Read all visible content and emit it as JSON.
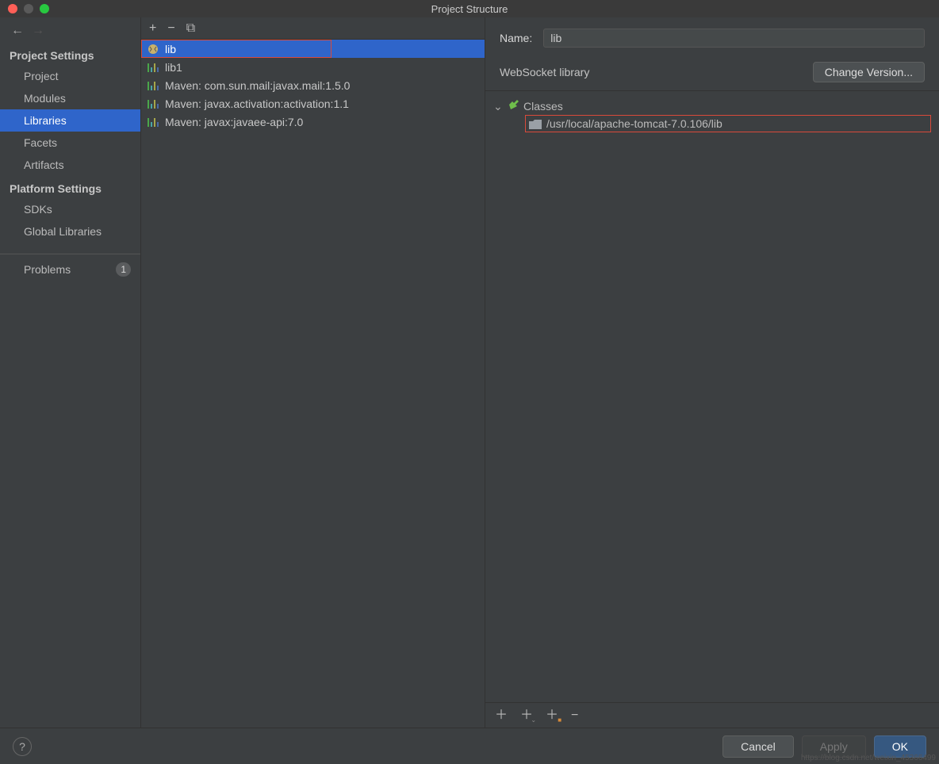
{
  "titlebar": {
    "title": "Project Structure"
  },
  "nav": {
    "backEnabled": true,
    "forwardEnabled": false
  },
  "sidebar": {
    "section1": "Project Settings",
    "items1": [
      {
        "label": "Project"
      },
      {
        "label": "Modules"
      },
      {
        "label": "Libraries",
        "selected": true
      },
      {
        "label": "Facets"
      },
      {
        "label": "Artifacts"
      }
    ],
    "section2": "Platform Settings",
    "items2": [
      {
        "label": "SDKs"
      },
      {
        "label": "Global Libraries"
      }
    ],
    "problems": {
      "label": "Problems",
      "count": "1"
    }
  },
  "toolbar": {
    "add": "+",
    "remove": "−",
    "copy": "⧉"
  },
  "libraries": [
    {
      "label": "lib",
      "type": "tomcat",
      "selected": true,
      "highlight": true
    },
    {
      "label": "lib1",
      "type": "java"
    },
    {
      "label": "Maven: com.sun.mail:javax.mail:1.5.0",
      "type": "maven"
    },
    {
      "label": "Maven: javax.activation:activation:1.1",
      "type": "maven"
    },
    {
      "label": "Maven: javax:javaee-api:7.0",
      "type": "maven"
    }
  ],
  "detail": {
    "nameLabel": "Name:",
    "nameValue": "lib",
    "libType": "WebSocket library",
    "changeVersion": "Change Version...",
    "tree": {
      "root": "Classes",
      "path": "/usr/local/apache-tomcat-7.0.106/lib"
    }
  },
  "footer": {
    "cancel": "Cancel",
    "apply": "Apply",
    "ok": "OK"
  },
  "watermark": "https://blog.csdn.net/weixin_45366499"
}
